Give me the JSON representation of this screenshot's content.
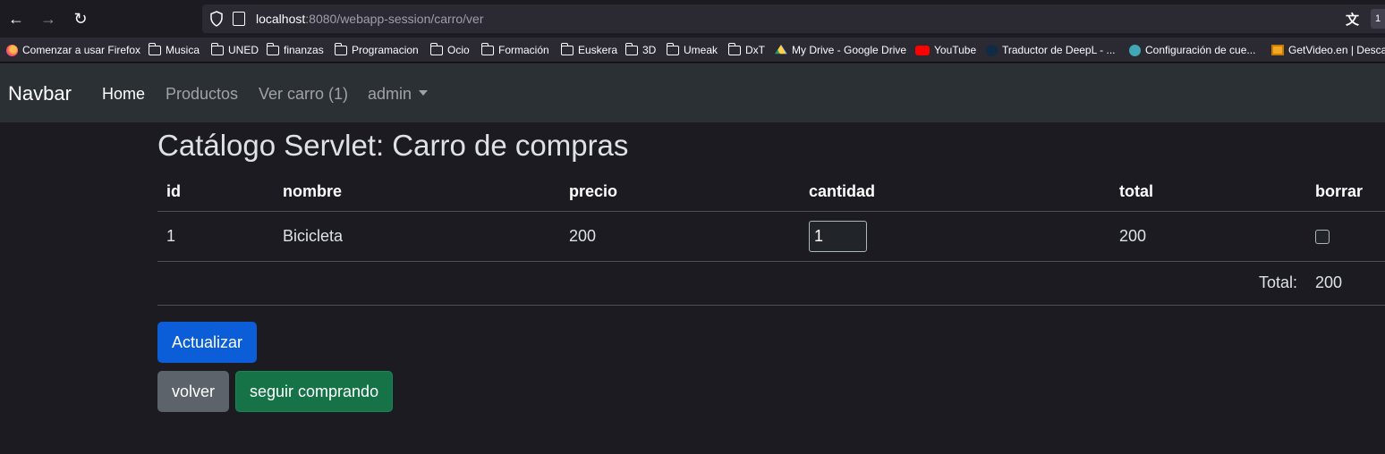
{
  "browser": {
    "url_host": "localhost",
    "url_rest": ":8080/webapp-session/carro/ver",
    "ext_badge": "1",
    "bookmarks": [
      {
        "label": "Comenzar a usar Firefox",
        "icon": "firefox-icon"
      },
      {
        "label": "Musica",
        "icon": "folder-icon"
      },
      {
        "label": "UNED",
        "icon": "folder-icon"
      },
      {
        "label": "finanzas",
        "icon": "folder-icon"
      },
      {
        "label": "Programacion",
        "icon": "folder-icon"
      },
      {
        "label": "Ocio",
        "icon": "folder-icon"
      },
      {
        "label": "Formación",
        "icon": "folder-icon"
      },
      {
        "label": "Euskera",
        "icon": "folder-icon"
      },
      {
        "label": "3D",
        "icon": "folder-icon"
      },
      {
        "label": "Umeak",
        "icon": "folder-icon"
      },
      {
        "label": "DxT",
        "icon": "folder-icon"
      },
      {
        "label": "My Drive - Google Drive",
        "icon": "google-drive-icon"
      },
      {
        "label": "YouTube",
        "icon": "youtube-icon"
      },
      {
        "label": "Traductor de DeepL - ...",
        "icon": "deepl-icon"
      },
      {
        "label": "Configuración de cue...",
        "icon": "settings-site-icon"
      },
      {
        "label": "GetVideo.en | Descar",
        "icon": "getvideo-icon"
      }
    ]
  },
  "navbar": {
    "brand": "Navbar",
    "links": [
      "Home",
      "Productos",
      "Ver carro (1)",
      "admin"
    ]
  },
  "page": {
    "title": "Catálogo Servlet: Carro de compras"
  },
  "table": {
    "headers": [
      "id",
      "nombre",
      "precio",
      "cantidad",
      "total",
      "borrar"
    ],
    "rows": [
      {
        "id": "1",
        "nombre": "Bicicleta",
        "precio": "200",
        "cantidad": "1",
        "total": "200"
      }
    ],
    "total_label": "Total:",
    "total_value": "200"
  },
  "buttons": {
    "update": "Actualizar",
    "back": "volver",
    "continue": "seguir comprando"
  },
  "colors": {
    "primary": "#0b5ed7",
    "secondary": "#5c636a",
    "success": "#157347",
    "navbar_bg": "#2b3035",
    "page_bg": "#1c1b22"
  }
}
